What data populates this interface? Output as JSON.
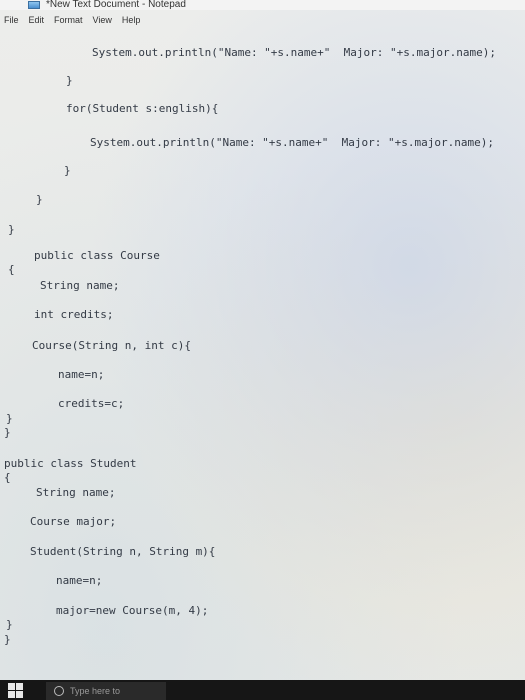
{
  "window": {
    "title": "*New Text Document - Notepad",
    "icon": "notepad-icon"
  },
  "menu": [
    "File",
    "Edit",
    "Format",
    "View",
    "Help"
  ],
  "code": [
    "System.out.println(\"Name: \"+s.name+\"  Major: \"+s.major.name);",
    "}",
    "for(Student s:english){",
    "System.out.println(\"Name: \"+s.name+\"  Major: \"+s.major.name);",
    "}",
    "}",
    "}",
    "public class Course",
    "{",
    "String name;",
    "int credits;",
    "Course(String n, int c){",
    "name=n;",
    "credits=c;",
    "}",
    "}",
    "public class Student",
    "{",
    "String name;",
    "Course major;",
    "Student(String n, String m){",
    "name=n;",
    "major=new Course(m, 4);",
    "}",
    "}"
  ],
  "taskbar": {
    "start_icon": "windows-start-icon",
    "search_placeholder": "Type here to",
    "search_icon": "search-icon"
  },
  "colors": {
    "code_text": "#333a45",
    "taskbar": "#161616"
  }
}
